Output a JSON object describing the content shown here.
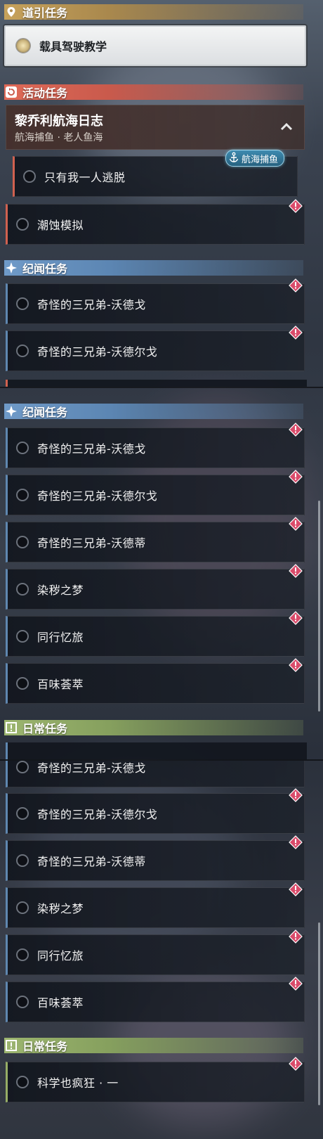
{
  "sections": {
    "guide": {
      "title": "道引任务",
      "item": "载具驾驶教学"
    },
    "event": {
      "title": "活动任务",
      "chain_title": "黎乔利航海日志",
      "chain_subtitle": "航海捕鱼 · 老人鱼海",
      "tag": "航海捕鱼",
      "items": [
        "只有我一人逃脱",
        "潮蚀模拟"
      ]
    },
    "lore": {
      "title": "纪闻任务"
    },
    "daily": {
      "title": "日常任务"
    }
  },
  "lore_items_short": [
    "奇怪的三兄弟-沃德戈",
    "奇怪的三兄弟-沃德尔戈"
  ],
  "lore_items_full": [
    "奇怪的三兄弟-沃德戈",
    "奇怪的三兄弟-沃德尔戈",
    "奇怪的三兄弟-沃德蒂",
    "染秽之梦",
    "同行忆旅",
    "百味荟萃"
  ],
  "daily_items": [
    "科学也疯狂 · 一"
  ],
  "colors": {
    "guide": "#c7a25b",
    "event": "#e06a58",
    "lore": "#6f9ac8",
    "daily": "#9cb56f",
    "alert": "#d94b6a",
    "tag": "#3e8bb0"
  },
  "icons": {
    "guide": "map-pin-icon",
    "event": "event-refresh-icon",
    "lore": "sparkle-icon",
    "daily": "exclamation-box-icon",
    "alert": "alert-diamond-icon",
    "collapse": "chevron-up-icon",
    "tag": "anchor-icon"
  }
}
